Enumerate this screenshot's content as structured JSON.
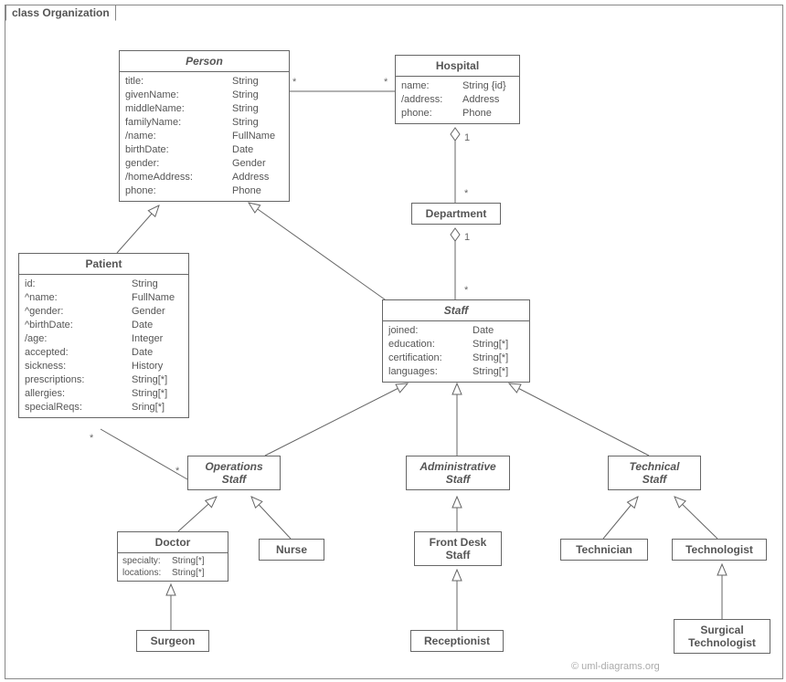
{
  "frame": {
    "title": "class Organization"
  },
  "watermark": "© uml-diagrams.org",
  "classes": {
    "person": {
      "name": "Person",
      "attrs": [
        {
          "k": "title:",
          "v": "String"
        },
        {
          "k": "givenName:",
          "v": "String"
        },
        {
          "k": "middleName:",
          "v": "String"
        },
        {
          "k": "familyName:",
          "v": "String"
        },
        {
          "k": "/name:",
          "v": "FullName"
        },
        {
          "k": "birthDate:",
          "v": "Date"
        },
        {
          "k": "gender:",
          "v": "Gender"
        },
        {
          "k": "/homeAddress:",
          "v": "Address"
        },
        {
          "k": "phone:",
          "v": "Phone"
        }
      ]
    },
    "hospital": {
      "name": "Hospital",
      "attrs": [
        {
          "k": "name:",
          "v": "String {id}"
        },
        {
          "k": "/address:",
          "v": "Address"
        },
        {
          "k": "phone:",
          "v": "Phone"
        }
      ]
    },
    "department": {
      "name": "Department"
    },
    "patient": {
      "name": "Patient",
      "attrs": [
        {
          "k": "id:",
          "v": "String"
        },
        {
          "k": "^name:",
          "v": "FullName"
        },
        {
          "k": "^gender:",
          "v": "Gender"
        },
        {
          "k": "^birthDate:",
          "v": "Date"
        },
        {
          "k": "/age:",
          "v": "Integer"
        },
        {
          "k": "accepted:",
          "v": "Date"
        },
        {
          "k": "sickness:",
          "v": "History"
        },
        {
          "k": "prescriptions:",
          "v": "String[*]"
        },
        {
          "k": "allergies:",
          "v": "String[*]"
        },
        {
          "k": "specialReqs:",
          "v": "Sring[*]"
        }
      ]
    },
    "staff": {
      "name": "Staff",
      "attrs": [
        {
          "k": "joined:",
          "v": "Date"
        },
        {
          "k": "education:",
          "v": "String[*]"
        },
        {
          "k": "certification:",
          "v": "String[*]"
        },
        {
          "k": "languages:",
          "v": "String[*]"
        }
      ]
    },
    "opstaff": {
      "name": "Operations",
      "name2": "Staff"
    },
    "admstaff": {
      "name": "Administrative",
      "name2": "Staff"
    },
    "techstaff": {
      "name": "Technical",
      "name2": "Staff"
    },
    "doctor": {
      "name": "Doctor",
      "attrs": [
        {
          "k": "specialty:",
          "v": "String[*]"
        },
        {
          "k": "locations:",
          "v": "String[*]"
        }
      ]
    },
    "nurse": {
      "name": "Nurse"
    },
    "frontdesk": {
      "name": "Front Desk",
      "name2": "Staff"
    },
    "technician": {
      "name": "Technician"
    },
    "technologist": {
      "name": "Technologist"
    },
    "surgeon": {
      "name": "Surgeon"
    },
    "receptionist": {
      "name": "Receptionist"
    },
    "surgtech": {
      "name": "Surgical",
      "name2": "Technologist"
    }
  },
  "mult": {
    "person_hospital_left": "*",
    "person_hospital_right": "*",
    "hospital_dept_one": "1",
    "hospital_dept_many": "*",
    "dept_staff_one": "1",
    "dept_staff_many": "*",
    "patient_opstaff_left": "*",
    "patient_opstaff_right": "*"
  }
}
